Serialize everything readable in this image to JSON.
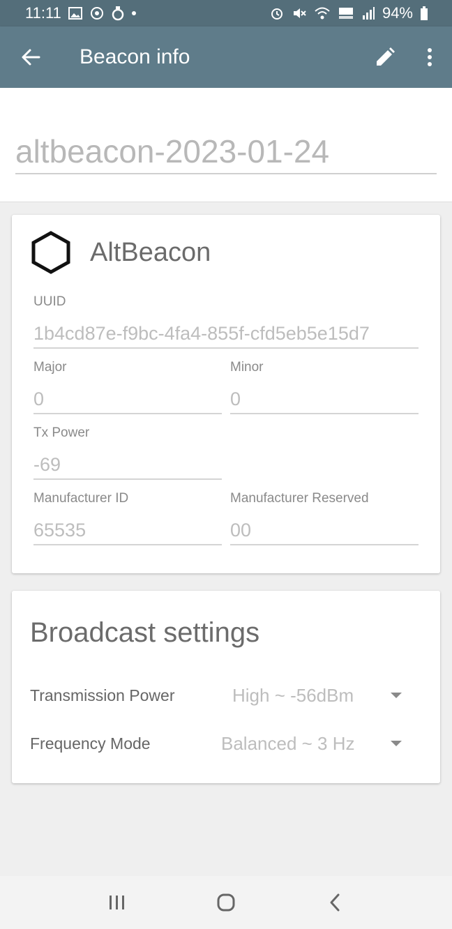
{
  "status_bar": {
    "time": "11:11",
    "battery": "94%",
    "left_icons": [
      "gallery-icon",
      "signal-app-icon",
      "sync-icon",
      "dot-icon"
    ],
    "right_icons": [
      "alarm-icon",
      "mute-icon",
      "wifi-icon",
      "hd-voice-icon",
      "cell-signal-icon",
      "battery-icon"
    ]
  },
  "app_bar": {
    "title": "Beacon info",
    "background": "#5f7c8a"
  },
  "beacon_name": {
    "value": "altbeacon-2023-01-24"
  },
  "beacon_card": {
    "type": "AltBeacon",
    "icon": "hexagon-icon",
    "uuid_label": "UUID",
    "uuid_value": "1b4cd87e-f9bc-4fa4-855f-cfd5eb5e15d7",
    "major_label": "Major",
    "major_value": "0",
    "minor_label": "Minor",
    "minor_value": "0",
    "tx_power_label": "Tx Power",
    "tx_power_value": "-69",
    "manufacturer_id_label": "Manufacturer ID",
    "manufacturer_id_value": "65535",
    "manufacturer_reserved_label": "Manufacturer Reserved",
    "manufacturer_reserved_value": "00"
  },
  "broadcast_settings": {
    "title": "Broadcast settings",
    "transmission_power_label": "Transmission Power",
    "transmission_power_value": "High ~ -56dBm",
    "frequency_mode_label": "Frequency Mode",
    "frequency_mode_value": "Balanced ~ 3 Hz"
  },
  "nav_bar": {
    "buttons": [
      "recents-icon",
      "home-icon",
      "back-icon"
    ]
  }
}
